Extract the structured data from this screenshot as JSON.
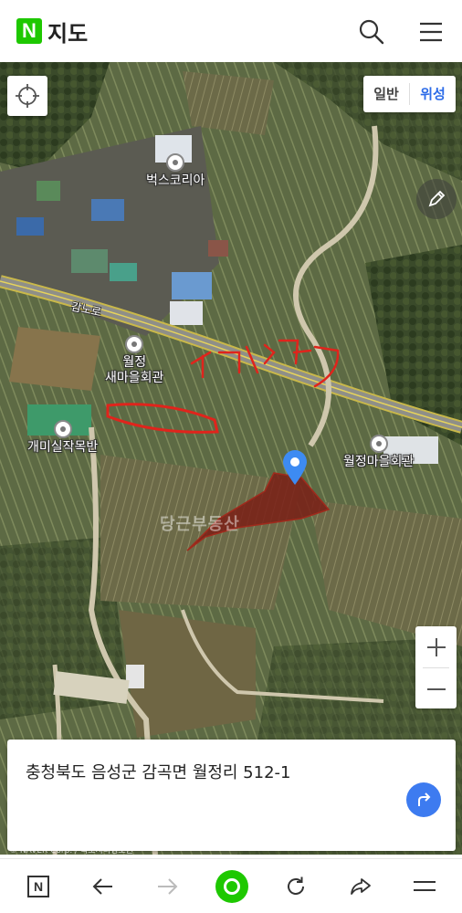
{
  "header": {
    "logo_letter": "N",
    "title": "지도",
    "search_icon": "search-icon",
    "menu_icon": "hamburger-menu-icon"
  },
  "map": {
    "type_toggle": [
      {
        "label": "일반",
        "active": false
      },
      {
        "label": "위성",
        "active": true
      }
    ],
    "pois": [
      {
        "name": "벅스코리아"
      },
      {
        "name": "월정\n새마을회관"
      },
      {
        "name": "개미실작목반"
      },
      {
        "name": "월정마을회관"
      }
    ],
    "road_label": "감노로",
    "watermark": "당근부동산",
    "copyright": "© NAVER Corp. / 국토지리정보원",
    "colors": {
      "accent": "#2d6ce8",
      "brand": "#1ec800",
      "annotation_red": "#e0241c",
      "parcel_fill": "#7a1f16",
      "marker": "#3d8bf2"
    }
  },
  "card": {
    "address": "충청북도 음성군 감곡면 월정리 512-1",
    "share_icon": "share-arrow-icon"
  },
  "bottom_nav": {
    "items": [
      "naver-home-icon",
      "back-arrow-icon",
      "forward-arrow-icon",
      "green-home-icon",
      "refresh-icon",
      "share-icon",
      "menu-icon"
    ]
  }
}
